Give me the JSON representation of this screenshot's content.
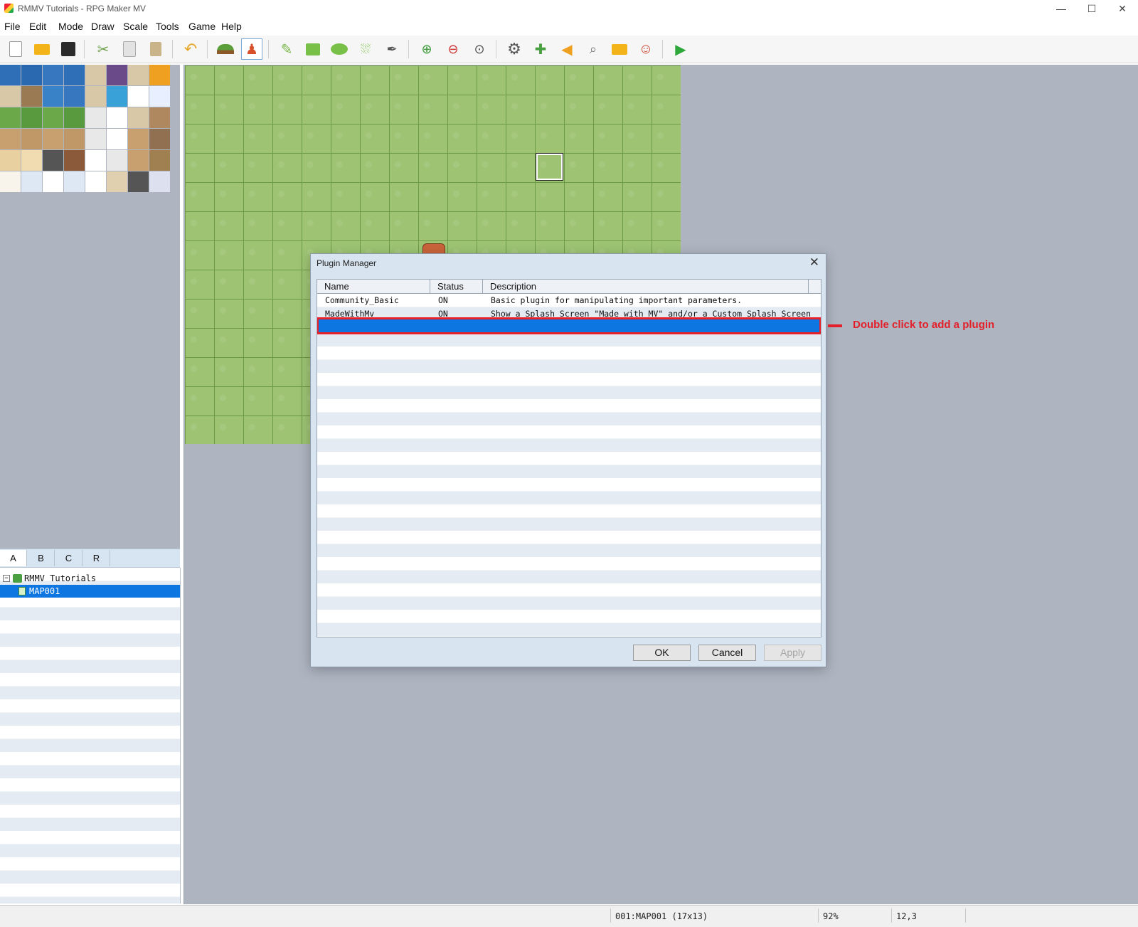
{
  "window": {
    "title": "RMMV Tutorials - RPG Maker MV",
    "minimize": "—",
    "maximize": "☐",
    "close": "✕"
  },
  "menubar": [
    "File",
    "Edit",
    "Mode",
    "Draw",
    "Scale",
    "Tools",
    "Game",
    "Help"
  ],
  "toolbar": {
    "items": [
      "new-project",
      "open-project",
      "save-project",
      "cut",
      "copy",
      "paste",
      "undo",
      "map-mode",
      "event-mode",
      "pencil",
      "rectangle",
      "ellipse",
      "flood-fill",
      "shadow-pen",
      "zoom-in",
      "zoom-out",
      "actual-size",
      "database",
      "plugin-manager",
      "sound-test",
      "event-searcher",
      "resource-manager",
      "character-generator",
      "playtest"
    ]
  },
  "tileset_tabs": [
    "A",
    "B",
    "C",
    "R"
  ],
  "map_tree": {
    "project": "RMMV Tutorials",
    "maps": [
      "MAP001"
    ]
  },
  "status_bar": {
    "map": "001:MAP001 (17x13)",
    "zoom": "92%",
    "coords": "12,3"
  },
  "plugin_manager": {
    "title": "Plugin Manager",
    "close": "✕",
    "columns": [
      "Name",
      "Status",
      "Description"
    ],
    "rows": [
      {
        "name": "Community_Basic",
        "status": "ON",
        "description": "Basic plugin for manipulating important parameters."
      },
      {
        "name": "MadeWithMv",
        "status": "ON",
        "description": "Show a Splash Screen \"Made with MV\" and/or a Custom Splash Screen be…"
      }
    ],
    "buttons": {
      "ok": "OK",
      "cancel": "Cancel",
      "apply": "Apply"
    }
  },
  "annotation": {
    "text": "Double click to add a plugin",
    "color": "#e3202a"
  }
}
